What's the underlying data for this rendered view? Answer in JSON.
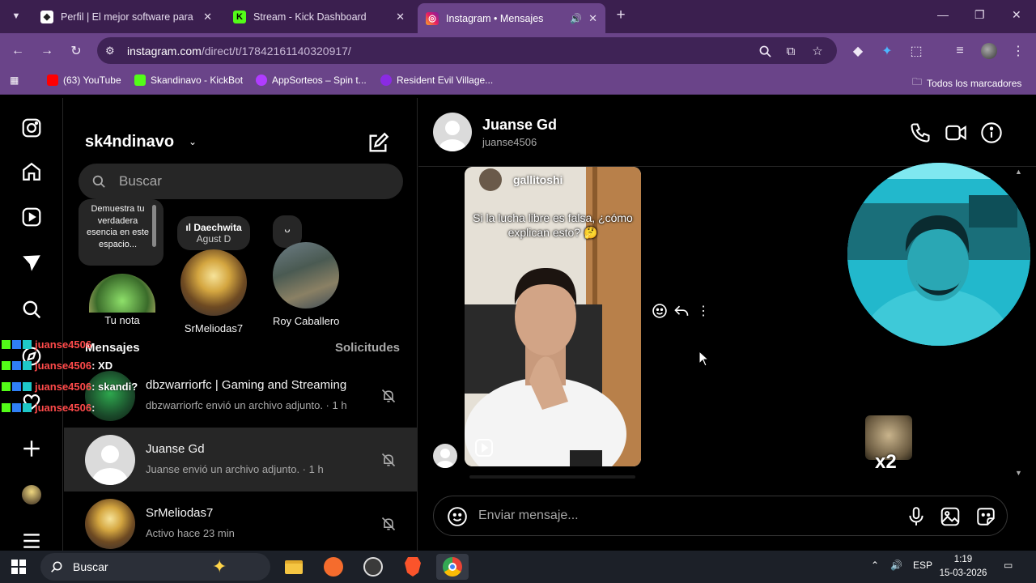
{
  "browser": {
    "tabs": [
      {
        "title": "Perfil | El mejor software para p",
        "favicon": "perfil-favicon",
        "active": false
      },
      {
        "title": "Stream - Kick Dashboard",
        "favicon": "kick-favicon",
        "active": false
      },
      {
        "title": "Instagram • Mensajes",
        "favicon": "instagram-favicon",
        "active": true
      }
    ],
    "url_domain": "instagram.com",
    "url_path": "/direct/t/17842161140320917/",
    "bookmarks": [
      {
        "label": "(63) YouTube",
        "color": "#ff0000"
      },
      {
        "label": "Skandinavo - KickBot",
        "color": "#53fc18"
      },
      {
        "label": "AppSorteos – Spin t...",
        "color": "#b03cff"
      },
      {
        "label": "Resident Evil Village...",
        "color": "#8a2be2"
      }
    ],
    "all_bookmarks": "Todos los marcadores"
  },
  "instagram": {
    "username": "sk4ndinavo",
    "search_placeholder": "Buscar",
    "notes": [
      {
        "text": "Demuestra tu verdadera esencia en este espacio...",
        "name": "Tu nota"
      },
      {
        "text_song": "Daechwita",
        "text_artist": "Agust D",
        "name": "SrMeliodas7"
      },
      {
        "text": "ᴗ",
        "name": "Roy Caballero"
      }
    ],
    "messages_title": "Mensajes",
    "requests_label": "Solicitudes",
    "conversations": [
      {
        "name": "dbzwarriorfc | Gaming and Streaming",
        "sub": "dbzwarriorfc envió un archivo adjunto. · 1 h",
        "selected": false
      },
      {
        "name": "Juanse Gd",
        "sub": "Juanse envió un archivo adjunto. · 1 h",
        "selected": true
      },
      {
        "name": "SrMeliodas7",
        "sub": "Activo hace 23 min",
        "selected": false
      }
    ],
    "chat_overlay": [
      {
        "user": "juanse4506",
        "msg": ""
      },
      {
        "user": "juanse4506",
        "msg": ": XD"
      },
      {
        "user": "juanse4506",
        "msg": ": skandi?"
      },
      {
        "user": "juanse4506",
        "msg": ":"
      }
    ],
    "thread": {
      "name": "Juanse Gd",
      "handle": "juanse4506",
      "reel_user": "gallitoshi",
      "reel_caption": "Si la lucha libre es falsa, ¿cómo explican esto? 🤔",
      "composer_placeholder": "Enviar mensaje..."
    },
    "sticker_text": "x2"
  },
  "taskbar": {
    "search_placeholder": "Buscar",
    "lang": "ESP",
    "time": "1:19",
    "date": "15-03-2026"
  },
  "colors": {
    "tabstrip": "#3b1f4f",
    "toolbar": "#6a4489",
    "ig_bg": "#000000",
    "selected_row": "#262626"
  }
}
